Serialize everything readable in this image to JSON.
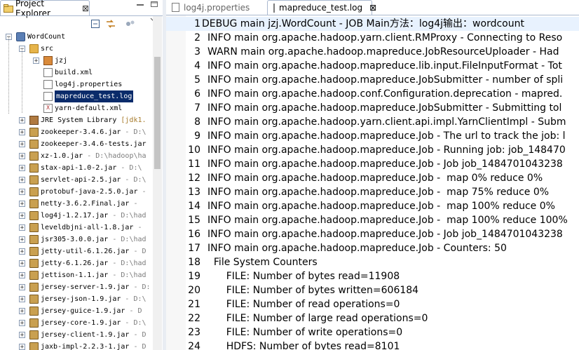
{
  "left_panel": {
    "tab_title": "Project Explorer",
    "close_glyph": "⊠",
    "icons": [
      "collapse-all-icon",
      "link-with-editor-icon",
      "view-menu-icon",
      "minimize-icon"
    ],
    "tree": [
      {
        "indent": 0,
        "exp": "−",
        "icon": "proj",
        "label": "WordCount"
      },
      {
        "indent": 1,
        "exp": "−",
        "icon": "folder",
        "label": "src"
      },
      {
        "indent": 2,
        "exp": "+",
        "icon": "pkg",
        "label": "jzj"
      },
      {
        "indent": 2,
        "exp": "",
        "icon": "file",
        "label": "build.xml"
      },
      {
        "indent": 2,
        "exp": "",
        "icon": "file",
        "label": "log4j.properties"
      },
      {
        "indent": 2,
        "exp": "",
        "icon": "file",
        "label": "mapreduce_test.log",
        "selected": true
      },
      {
        "indent": 2,
        "exp": "",
        "icon": "xml",
        "label": "yarn-default.xml"
      },
      {
        "indent": 1,
        "exp": "+",
        "icon": "lib",
        "label": "JRE System Library",
        "path": " [jdk1.",
        "highlight": true
      },
      {
        "indent": 1,
        "exp": "+",
        "icon": "jar",
        "label": "zookeeper-3.4.6.jar",
        "path": " - D:\\"
      },
      {
        "indent": 1,
        "exp": "+",
        "icon": "jar",
        "label": "zookeeper-3.4.6-tests.jar",
        "path": ""
      },
      {
        "indent": 1,
        "exp": "+",
        "icon": "jar",
        "label": "xz-1.0.jar",
        "path": " - D:\\hadoop\\ha"
      },
      {
        "indent": 1,
        "exp": "+",
        "icon": "jar",
        "label": "stax-api-1.0-2.jar",
        "path": " - D:\\"
      },
      {
        "indent": 1,
        "exp": "+",
        "icon": "jar",
        "label": "servlet-api-2.5.jar",
        "path": " - D:\\"
      },
      {
        "indent": 1,
        "exp": "+",
        "icon": "jar",
        "label": "protobuf-java-2.5.0.jar",
        "path": " -"
      },
      {
        "indent": 1,
        "exp": "+",
        "icon": "jar",
        "label": "netty-3.6.2.Final.jar",
        "path": " -"
      },
      {
        "indent": 1,
        "exp": "+",
        "icon": "jar",
        "label": "log4j-1.2.17.jar",
        "path": " - D:\\had"
      },
      {
        "indent": 1,
        "exp": "+",
        "icon": "jar",
        "label": "leveldbjni-all-1.8.jar",
        "path": " -"
      },
      {
        "indent": 1,
        "exp": "+",
        "icon": "jar",
        "label": "jsr305-3.0.0.jar",
        "path": " - D:\\had"
      },
      {
        "indent": 1,
        "exp": "+",
        "icon": "jar",
        "label": "jetty-util-6.1.26.jar",
        "path": " - D"
      },
      {
        "indent": 1,
        "exp": "+",
        "icon": "jar",
        "label": "jetty-6.1.26.jar",
        "path": " - D:\\had"
      },
      {
        "indent": 1,
        "exp": "+",
        "icon": "jar",
        "label": "jettison-1.1.jar",
        "path": " - D:\\had"
      },
      {
        "indent": 1,
        "exp": "+",
        "icon": "jar",
        "label": "jersey-server-1.9.jar",
        "path": " - D:"
      },
      {
        "indent": 1,
        "exp": "+",
        "icon": "jar",
        "label": "jersey-json-1.9.jar",
        "path": " - D:\\"
      },
      {
        "indent": 1,
        "exp": "+",
        "icon": "jar",
        "label": "jersey-guice-1.9.jar",
        "path": " - D"
      },
      {
        "indent": 1,
        "exp": "+",
        "icon": "jar",
        "label": "jersey-core-1.9.jar",
        "path": " - D:\\"
      },
      {
        "indent": 1,
        "exp": "+",
        "icon": "jar",
        "label": "jersey-client-1.9.jar",
        "path": " - D"
      },
      {
        "indent": 1,
        "exp": "+",
        "icon": "jar",
        "label": "jaxb-impl-2.2.3-1.jar",
        "path": " - D"
      }
    ]
  },
  "editor": {
    "tabs": [
      {
        "label": "log4j.properties",
        "active": false
      },
      {
        "label": "mapreduce_test.log",
        "active": true
      }
    ],
    "close_glyph": "⊠",
    "lines": [
      {
        "n": "1",
        "t": "DEBUG main jzj.WordCount - JOB Main方法：log4j输出：wordcount",
        "cur": true
      },
      {
        "n": "2",
        "t": "INFO main org.apache.hadoop.yarn.client.RMProxy - Connecting to Reso"
      },
      {
        "n": "3",
        "t": "WARN main org.apache.hadoop.mapreduce.JobResourceUploader - Had"
      },
      {
        "n": "4",
        "t": "INFO main org.apache.hadoop.mapreduce.lib.input.FileInputFormat - Tot"
      },
      {
        "n": "5",
        "t": "INFO main org.apache.hadoop.mapreduce.JobSubmitter - number of spli"
      },
      {
        "n": "6",
        "t": "INFO main org.apache.hadoop.conf.Configuration.deprecation - mapred."
      },
      {
        "n": "7",
        "t": "INFO main org.apache.hadoop.mapreduce.JobSubmitter - Submitting tol"
      },
      {
        "n": "8",
        "t": "INFO main org.apache.hadoop.yarn.client.api.impl.YarnClientImpl - Subm"
      },
      {
        "n": "9",
        "t": "INFO main org.apache.hadoop.mapreduce.Job - The url to track the job: l"
      },
      {
        "n": "10",
        "t": "INFO main org.apache.hadoop.mapreduce.Job - Running job: job_148470"
      },
      {
        "n": "11",
        "t": "INFO main org.apache.hadoop.mapreduce.Job - Job job_1484701043238"
      },
      {
        "n": "12",
        "t": "INFO main org.apache.hadoop.mapreduce.Job -  map 0% reduce 0%"
      },
      {
        "n": "13",
        "t": "INFO main org.apache.hadoop.mapreduce.Job -  map 75% reduce 0%"
      },
      {
        "n": "14",
        "t": "INFO main org.apache.hadoop.mapreduce.Job -  map 100% reduce 0%"
      },
      {
        "n": "15",
        "t": "INFO main org.apache.hadoop.mapreduce.Job -  map 100% reduce 100%"
      },
      {
        "n": "16",
        "t": "INFO main org.apache.hadoop.mapreduce.Job - Job job_1484701043238"
      },
      {
        "n": "17",
        "t": "INFO main org.apache.hadoop.mapreduce.Job - Counters: 50"
      },
      {
        "n": "18",
        "t": "  File System Counters"
      },
      {
        "n": "19",
        "t": "      FILE: Number of bytes read=11908"
      },
      {
        "n": "20",
        "t": "      FILE: Number of bytes written=606184"
      },
      {
        "n": "21",
        "t": "      FILE: Number of read operations=0"
      },
      {
        "n": "22",
        "t": "      FILE: Number of large read operations=0"
      },
      {
        "n": "23",
        "t": "      FILE: Number of write operations=0"
      },
      {
        "n": "24",
        "t": "      HDFS: Number of bytes read=8101"
      }
    ]
  }
}
